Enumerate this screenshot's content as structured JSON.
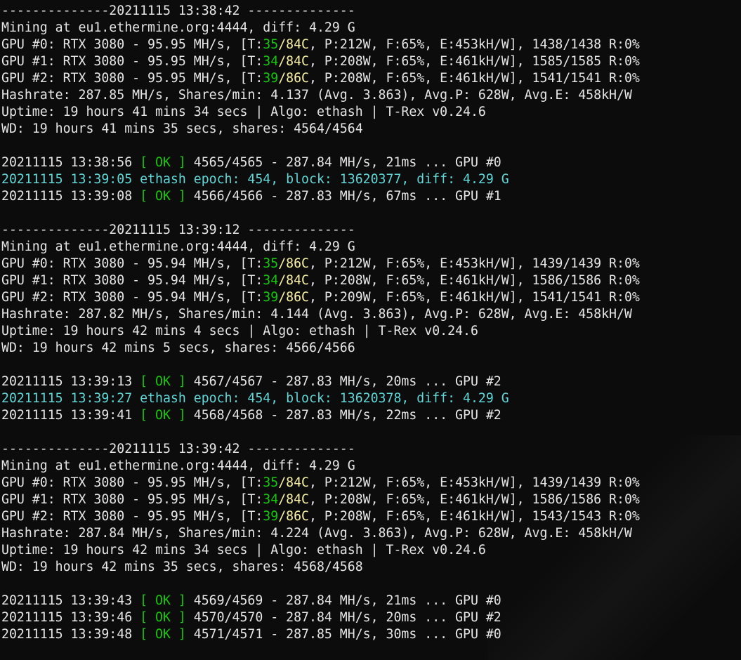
{
  "blocks": [
    {
      "type": "stats",
      "header": "--------------20211115 13:38:42 --------------",
      "mining": "Mining at eu1.ethermine.org:4444, diff: 4.29 G",
      "gpus": [
        {
          "prefix": "GPU #0: RTX 3080 - 95.95 MH/s, [T:",
          "temp": "35",
          "sep": "/",
          "mem": "84C",
          "suffix": ", P:212W, F:65%, E:453kH/W], 1438/1438 R:0%"
        },
        {
          "prefix": "GPU #1: RTX 3080 - 95.95 MH/s, [T:",
          "temp": "34",
          "sep": "/",
          "mem": "84C",
          "suffix": ", P:208W, F:65%, E:461kH/W], 1585/1585 R:0%"
        },
        {
          "prefix": "GPU #2: RTX 3080 - 95.95 MH/s, [T:",
          "temp": "39",
          "sep": "/",
          "mem": "86C",
          "suffix": ", P:208W, F:65%, E:461kH/W], 1541/1541 R:0%"
        }
      ],
      "hashrate": "Hashrate: 287.85 MH/s, Shares/min: 4.137 (Avg. 3.863), Avg.P: 628W, Avg.E: 458kH/W",
      "uptime": "Uptime: 19 hours 41 mins 34 secs | Algo: ethash | T-Rex v0.24.6",
      "wd": "WD: 19 hours 41 mins 35 secs, shares: 4564/4564"
    },
    {
      "type": "events",
      "events": [
        {
          "kind": "ok",
          "time": "20211115 13:38:56 ",
          "ok": "[ OK ]",
          "rest": " 4565/4565 - 287.84 MH/s, 21ms ... GPU #0"
        },
        {
          "kind": "epoch",
          "text": "20211115 13:39:05 ethash epoch: 454, block: 13620377, diff: 4.29 G"
        },
        {
          "kind": "ok",
          "time": "20211115 13:39:08 ",
          "ok": "[ OK ]",
          "rest": " 4566/4566 - 287.83 MH/s, 67ms ... GPU #1"
        }
      ]
    },
    {
      "type": "stats",
      "header": "--------------20211115 13:39:12 --------------",
      "mining": "Mining at eu1.ethermine.org:4444, diff: 4.29 G",
      "gpus": [
        {
          "prefix": "GPU #0: RTX 3080 - 95.94 MH/s, [T:",
          "temp": "35",
          "sep": "/",
          "mem": "86C",
          "suffix": ", P:212W, F:65%, E:453kH/W], 1439/1439 R:0%"
        },
        {
          "prefix": "GPU #1: RTX 3080 - 95.94 MH/s, [T:",
          "temp": "34",
          "sep": "/",
          "mem": "84C",
          "suffix": ", P:208W, F:65%, E:461kH/W], 1586/1586 R:0%"
        },
        {
          "prefix": "GPU #2: RTX 3080 - 95.94 MH/s, [T:",
          "temp": "39",
          "sep": "/",
          "mem": "86C",
          "suffix": ", P:209W, F:65%, E:461kH/W], 1541/1541 R:0%"
        }
      ],
      "hashrate": "Hashrate: 287.82 MH/s, Shares/min: 4.144 (Avg. 3.863), Avg.P: 628W, Avg.E: 458kH/W",
      "uptime": "Uptime: 19 hours 42 mins 4 secs | Algo: ethash | T-Rex v0.24.6",
      "wd": "WD: 19 hours 42 mins 5 secs, shares: 4566/4566"
    },
    {
      "type": "events",
      "events": [
        {
          "kind": "ok",
          "time": "20211115 13:39:13 ",
          "ok": "[ OK ]",
          "rest": " 4567/4567 - 287.83 MH/s, 20ms ... GPU #2"
        },
        {
          "kind": "epoch",
          "text": "20211115 13:39:27 ethash epoch: 454, block: 13620378, diff: 4.29 G"
        },
        {
          "kind": "ok",
          "time": "20211115 13:39:41 ",
          "ok": "[ OK ]",
          "rest": " 4568/4568 - 287.83 MH/s, 22ms ... GPU #2"
        }
      ]
    },
    {
      "type": "stats",
      "header": "--------------20211115 13:39:42 --------------",
      "mining": "Mining at eu1.ethermine.org:4444, diff: 4.29 G",
      "gpus": [
        {
          "prefix": "GPU #0: RTX 3080 - 95.95 MH/s, [T:",
          "temp": "35",
          "sep": "/",
          "mem": "84C",
          "suffix": ", P:212W, F:65%, E:453kH/W], 1439/1439 R:0%"
        },
        {
          "prefix": "GPU #1: RTX 3080 - 95.95 MH/s, [T:",
          "temp": "34",
          "sep": "/",
          "mem": "84C",
          "suffix": ", P:208W, F:65%, E:461kH/W], 1586/1586 R:0%"
        },
        {
          "prefix": "GPU #2: RTX 3080 - 95.95 MH/s, [T:",
          "temp": "39",
          "sep": "/",
          "mem": "86C",
          "suffix": ", P:208W, F:65%, E:461kH/W], 1543/1543 R:0%"
        }
      ],
      "hashrate": "Hashrate: 287.84 MH/s, Shares/min: 4.224 (Avg. 3.863), Avg.P: 628W, Avg.E: 458kH/W",
      "uptime": "Uptime: 19 hours 42 mins 34 secs | Algo: ethash | T-Rex v0.24.6",
      "wd": "WD: 19 hours 42 mins 35 secs, shares: 4568/4568"
    },
    {
      "type": "events",
      "events": [
        {
          "kind": "ok",
          "time": "20211115 13:39:43 ",
          "ok": "[ OK ]",
          "rest": " 4569/4569 - 287.84 MH/s, 21ms ... GPU #0"
        },
        {
          "kind": "ok",
          "time": "20211115 13:39:46 ",
          "ok": "[ OK ]",
          "rest": " 4570/4570 - 287.84 MH/s, 20ms ... GPU #2"
        },
        {
          "kind": "ok",
          "time": "20211115 13:39:48 ",
          "ok": "[ OK ]",
          "rest": " 4571/4571 - 287.85 MH/s, 30ms ... GPU #0"
        }
      ]
    }
  ],
  "colors": {
    "background": "#0c0c0c",
    "text": "#e6e6e6",
    "ok_green": "#16c60c",
    "temp_green": "#16c60c",
    "mem_yellow": "#f9f1a5",
    "epoch_cyan": "#61d6d6"
  }
}
